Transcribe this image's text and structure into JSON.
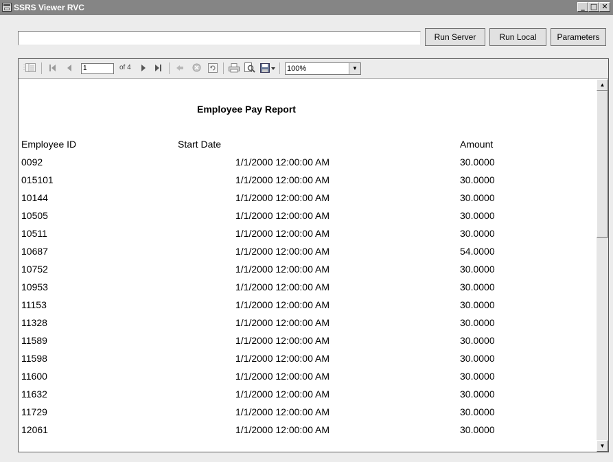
{
  "window": {
    "title": "SSRS Viewer RVC",
    "minimize": "_",
    "maximize": "□",
    "close": "✕"
  },
  "address": {
    "value": ""
  },
  "buttons": {
    "run_server": "Run Server",
    "run_local": "Run Local",
    "parameters": "Parameters"
  },
  "toolbar": {
    "page": "1",
    "of_pages": "of 4",
    "zoom": "100%",
    "zoom_arrow": "▼"
  },
  "report": {
    "title": "Employee Pay Report",
    "columns": {
      "id": "Employee ID",
      "date": "Start Date",
      "amount": "Amount"
    },
    "rows": [
      {
        "id": "0092",
        "date": "1/1/2000 12:00:00 AM",
        "amount": "30.0000"
      },
      {
        "id": "015101",
        "date": "1/1/2000 12:00:00 AM",
        "amount": "30.0000"
      },
      {
        "id": "10144",
        "date": "1/1/2000 12:00:00 AM",
        "amount": "30.0000"
      },
      {
        "id": "10505",
        "date": "1/1/2000 12:00:00 AM",
        "amount": "30.0000"
      },
      {
        "id": "10511",
        "date": "1/1/2000 12:00:00 AM",
        "amount": "30.0000"
      },
      {
        "id": "10687",
        "date": "1/1/2000 12:00:00 AM",
        "amount": "54.0000"
      },
      {
        "id": "10752",
        "date": "1/1/2000 12:00:00 AM",
        "amount": "30.0000"
      },
      {
        "id": "10953",
        "date": "1/1/2000 12:00:00 AM",
        "amount": "30.0000"
      },
      {
        "id": "11153",
        "date": "1/1/2000 12:00:00 AM",
        "amount": "30.0000"
      },
      {
        "id": "11328",
        "date": "1/1/2000 12:00:00 AM",
        "amount": "30.0000"
      },
      {
        "id": "11589",
        "date": "1/1/2000 12:00:00 AM",
        "amount": "30.0000"
      },
      {
        "id": "11598",
        "date": "1/1/2000 12:00:00 AM",
        "amount": "30.0000"
      },
      {
        "id": "11600",
        "date": "1/1/2000 12:00:00 AM",
        "amount": "30.0000"
      },
      {
        "id": "11632",
        "date": "1/1/2000 12:00:00 AM",
        "amount": "30.0000"
      },
      {
        "id": "11729",
        "date": "1/1/2000 12:00:00 AM",
        "amount": "30.0000"
      },
      {
        "id": "12061",
        "date": "1/1/2000 12:00:00 AM",
        "amount": "30.0000"
      }
    ]
  },
  "scroll": {
    "up": "▲",
    "down": "▼"
  }
}
